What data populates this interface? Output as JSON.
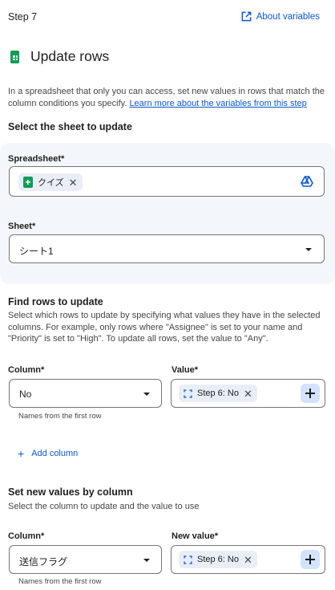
{
  "header": {
    "step_label": "Step 7",
    "about_label": "About variables",
    "title": "Update rows"
  },
  "description": {
    "text": "In a spreadsheet that only you can access, set new values in rows that match the column conditions you specify. ",
    "link": "Learn more about the variables from this step"
  },
  "select_sheet": {
    "heading": "Select the sheet to update",
    "spreadsheet_label": "Spreadsheet*",
    "spreadsheet_chip": "クイズ",
    "sheet_label": "Sheet*",
    "sheet_value": "シート1"
  },
  "find_rows": {
    "heading": "Find rows to update",
    "description": "Select which rows to update by specifying what values they have in the selected columns. For example, only rows where \"Assignee\" is set to your name and \"Priority\" is set to \"High\". To update all rows, set the value to \"Any\".",
    "column_label": "Column*",
    "value_label": "Value*",
    "column_value": "No",
    "value_chip": "Step 6: No",
    "helper": "Names from the first row",
    "add_column": "Add column"
  },
  "set_values": {
    "heading": "Set new values by column",
    "description": "Select the column to update and the value to use",
    "column_label": "Column*",
    "value_label": "New value*",
    "column_value": "送信フラグ",
    "value_chip": "Step 6: No",
    "helper": "Names from the first row"
  },
  "icons": {
    "about": "open-in-new-icon",
    "title": "google-sheets-icon",
    "drive": "google-drive-icon",
    "variable": "variable-brackets-icon",
    "add": "plus-icon"
  },
  "colors": {
    "accent": "#0b57d0",
    "sheets_green": "#0f9d58",
    "panel_bg": "#f3f6fb",
    "chip_bg": "#e9eef6",
    "plus_bg": "#d3e3fd"
  }
}
